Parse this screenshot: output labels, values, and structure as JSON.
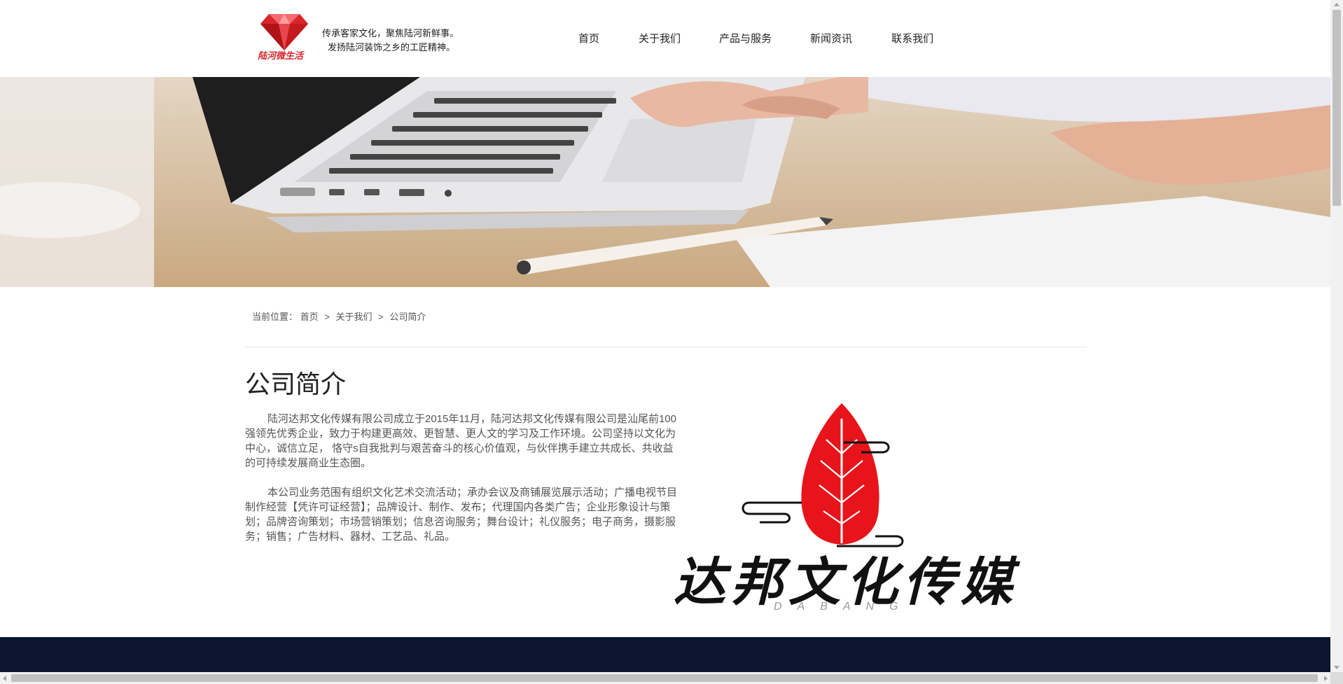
{
  "header": {
    "logo_text": "陆河微生活",
    "slogan_line1": "传承客家文化，聚焦陆河新鲜事。",
    "slogan_line2": "发扬陆河装饰之乡的工匠精神。"
  },
  "nav": {
    "items": [
      {
        "label": "首页"
      },
      {
        "label": "关于我们"
      },
      {
        "label": "产品与服务"
      },
      {
        "label": "新闻资讯"
      },
      {
        "label": "联系我们"
      }
    ]
  },
  "breadcrumb": {
    "prefix": "当前位置：",
    "items": [
      "首页",
      "关于我们",
      "公司简介"
    ],
    "separator": ">"
  },
  "content": {
    "title": "公司简介",
    "paragraphs": [
      "陆河达邦文化传媒有限公司成立于2015年11月，陆河达邦文化传媒有限公司是汕尾前100强领先优秀企业，致力于构建更高效、更智慧、更人文的学习及工作环境。公司坚持以文化为中心，诚信立足， 恪守s自我批判与艰苦奋斗的核心价值观，与伙伴携手建立共成长、共收益的可持续发展商业生态圈。",
      "本公司业务范围有组织文化艺术交流活动；承办会议及商铺展览展示活动；广播电视节目制作经营【凭许可证经营】；品牌设计、制作、发布；代理国内各类广告；企业形象设计与策划；品牌咨询策划；市场营销策划；信息咨询服务；舞台设计；礼仪服务；电子商务，摄影服务；销售；广告材料、器材、工艺品、礼品。"
    ],
    "brand_name": "达邦文化传媒",
    "brand_sub": "DABANG"
  },
  "colors": {
    "footer_bg": "#0b1530",
    "logo_red": "#d8262c",
    "leaf_red": "#e8141b"
  },
  "icons": {
    "logo": "red-gem-icon",
    "brand": "red-leaf-logo-icon"
  }
}
